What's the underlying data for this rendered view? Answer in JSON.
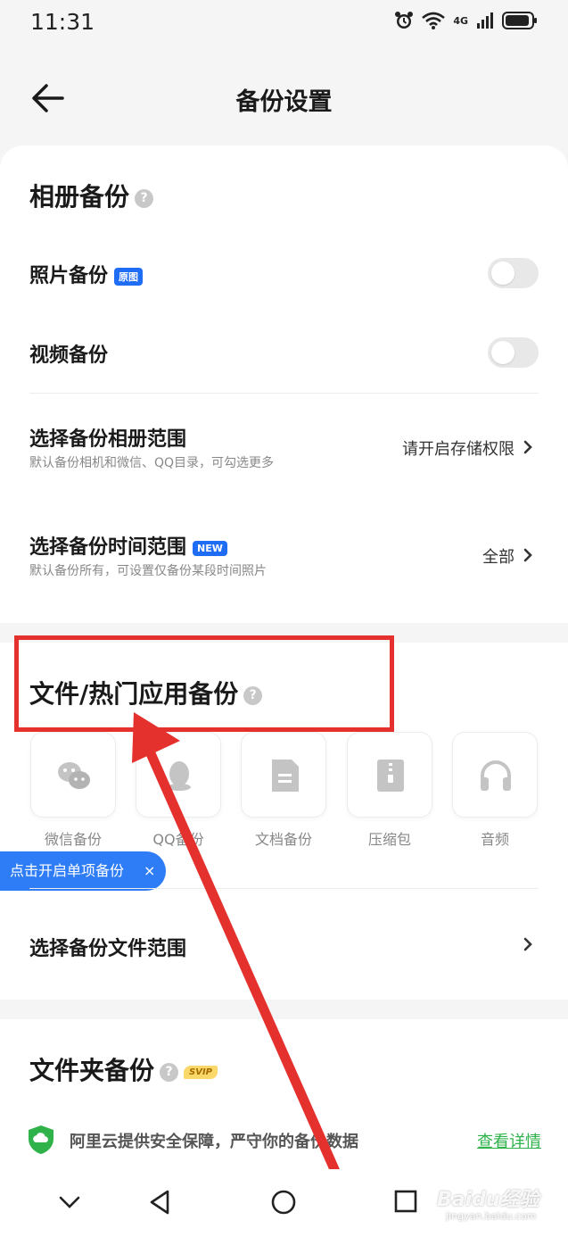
{
  "status_bar": {
    "time": "11:31",
    "network": "4G"
  },
  "header": {
    "title": "备份设置"
  },
  "album_backup": {
    "title": "相册备份",
    "photo_backup": {
      "label": "照片备份",
      "badge": "原图",
      "enabled": false
    },
    "video_backup": {
      "label": "视频备份",
      "enabled": false
    },
    "album_range": {
      "label": "选择备份相册范围",
      "sub": "默认备份相机和微信、QQ目录，可勾选更多",
      "value": "请开启存储权限"
    },
    "time_range": {
      "label": "选择备份时间范围",
      "badge": "NEW",
      "sub": "默认备份所有，可设置仅备份某段时间照片",
      "value": "全部"
    }
  },
  "file_backup": {
    "title": "文件/热门应用备份",
    "apps": [
      {
        "label": "微信备份",
        "icon": "wechat-icon"
      },
      {
        "label": "QQ备份",
        "icon": "qq-icon"
      },
      {
        "label": "文档备份",
        "icon": "document-icon"
      },
      {
        "label": "压缩包",
        "icon": "zip-icon"
      },
      {
        "label": "音频",
        "icon": "headphones-icon"
      }
    ],
    "tooltip": "点击开启单项备份",
    "tooltip_close": "×",
    "file_range_label": "选择备份文件范围"
  },
  "folder_backup": {
    "title": "文件夹备份",
    "badge": "SVIP",
    "notice": "阿里云提供安全保障，严守你的备份数据",
    "notice_link": "查看详情"
  },
  "watermark": {
    "main": "Baidu经验",
    "sub": "jingyan.baidu.com"
  },
  "colors": {
    "accent_blue": "#1f6cf5",
    "link_green": "#2fb24a",
    "annotation_red": "#e5312e",
    "tooltip_blue": "#2e7cf6"
  }
}
